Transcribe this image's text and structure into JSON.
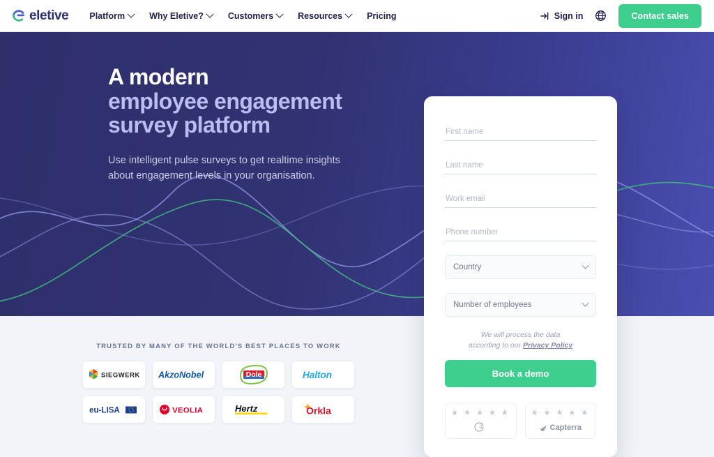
{
  "header": {
    "brand_name": "eletive",
    "brand_mark_icon": "eletive-circle-logo",
    "nav": [
      {
        "label": "Platform",
        "has_dropdown": true
      },
      {
        "label": "Why Eletive?",
        "has_dropdown": true
      },
      {
        "label": "Customers",
        "has_dropdown": true
      },
      {
        "label": "Resources",
        "has_dropdown": true
      },
      {
        "label": "Pricing",
        "has_dropdown": false
      }
    ],
    "signin_label": "Sign in",
    "signin_icon": "login-arrow-icon",
    "language_icon": "globe-icon",
    "contact_sales_label": "Contact sales",
    "accent_green": "#3ecf8e",
    "nav_text_color": "#20234f"
  },
  "hero": {
    "heading_line1": "A modern",
    "heading_line2": "employee engagement",
    "heading_line3": "survey platform",
    "subheading_line1": "Use intelligent pulse surveys to get realtime insights",
    "subheading_line2": "about engagement levels in your organisation.",
    "bg_gradient_start": "#2e2f6b",
    "bg_gradient_end": "#4a4eb0",
    "heading_highlight_color": "#ffffff",
    "heading_body_color": "#b9bdf0",
    "wave_color_purple": "#7a7fd4",
    "wave_color_green": "#3fae80"
  },
  "form": {
    "fields": [
      {
        "name": "first-name",
        "placeholder": "First name",
        "value": ""
      },
      {
        "name": "last-name",
        "placeholder": "Last name",
        "value": ""
      },
      {
        "name": "work-email",
        "placeholder": "Work email",
        "value": ""
      },
      {
        "name": "phone-number",
        "placeholder": "Phone number",
        "value": ""
      }
    ],
    "selects": [
      {
        "name": "country",
        "label": "Country",
        "icon": "chevron-down-icon"
      },
      {
        "name": "number-of-employees",
        "label": "Number of employees",
        "icon": "chevron-down-icon"
      }
    ],
    "privacy_text_line1": "We will process the data",
    "privacy_text_line2": "according to our",
    "privacy_link_label": "Privacy Policy",
    "submit_label": "Book a demo",
    "submit_color": "#3ecf8e"
  },
  "reviews": [
    {
      "name": "g2",
      "stars": "★ ★ ★ ★ ★",
      "label": "",
      "icon": "g2-logo-icon"
    },
    {
      "name": "capterra",
      "stars": "★ ★ ★ ★ ★",
      "label": "Capterra",
      "icon": "capterra-logo-icon"
    }
  ],
  "trusted": {
    "title": "TRUSTED BY MANY OF THE WORLD'S BEST PLACES TO WORK",
    "logos": [
      {
        "name": "siegwerk",
        "label": "SIEGWERK"
      },
      {
        "name": "akzonobel",
        "label": "AkzoNobel"
      },
      {
        "name": "dole",
        "label": "Dole"
      },
      {
        "name": "halton",
        "label": "Halton"
      },
      {
        "name": "eu-lisa",
        "label": "eu-LISA"
      },
      {
        "name": "veolia",
        "label": "VEOLIA"
      },
      {
        "name": "hertz",
        "label": "Hertz"
      },
      {
        "name": "orkla",
        "label": "Orkla"
      }
    ]
  },
  "page_background": "#f2f4f9"
}
